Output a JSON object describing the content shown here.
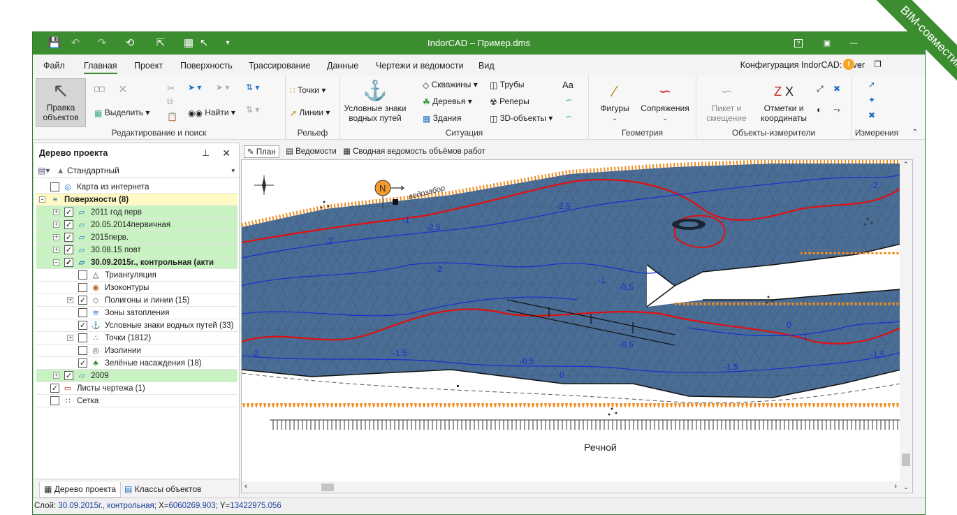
{
  "window": {
    "title": "IndorCAD – Пример.dms"
  },
  "menu": {
    "items": [
      "Файл",
      "Главная",
      "Проект",
      "Поверхность",
      "Трассирование",
      "Данные",
      "Чертежи и ведомости",
      "Вид"
    ],
    "config_label": "Конфигурация IndorCAD: River"
  },
  "ribbon": {
    "edit_objects": "Правка объектов",
    "select": "Выделить",
    "find": "Найти",
    "group_edit": "Редактирование и поиск",
    "points": "Точки",
    "lines": "Линии",
    "group_relief": "Рельеф",
    "water_signs": "Условные знаки водных путей",
    "wells": "Скважины",
    "trees": "Деревья",
    "buildings": "Здания",
    "pipes": "Трубы",
    "benchmarks": "Реперы",
    "objects3d": "3D-объекты",
    "text_glyph": "Aa",
    "group_situation": "Ситуация",
    "figures": "Фигуры",
    "joins": "Сопряжения",
    "group_geometry": "Геометрия",
    "picket": "Пикет и смещение",
    "marks": "Отметки и координаты",
    "group_measure_objects": "Объекты-измерители",
    "group_measure": "Измерения"
  },
  "left_panel": {
    "title": "Дерево проекта",
    "style": "Стандартный",
    "tree": [
      {
        "label": "Карта из интернета",
        "level": 0,
        "checked": false,
        "expand": "",
        "bg": "",
        "bold": false,
        "icon": "globe-icon"
      },
      {
        "label": "Поверхности (8)",
        "level": 0,
        "checked": null,
        "expand": "-",
        "bg": "yellow",
        "bold": true,
        "icon": "surfaces-icon"
      },
      {
        "label": "2011 год перв",
        "level": 1,
        "checked": true,
        "expand": "+",
        "bg": "green",
        "bold": false,
        "icon": "surface-icon"
      },
      {
        "label": "20.05.2014первичная",
        "level": 1,
        "checked": true,
        "expand": "+",
        "bg": "green",
        "bold": false,
        "icon": "surface-icon"
      },
      {
        "label": "2015перв.",
        "level": 1,
        "checked": true,
        "expand": "+",
        "bg": "green",
        "bold": false,
        "icon": "surface-icon"
      },
      {
        "label": "30.08.15 повт",
        "level": 1,
        "checked": true,
        "expand": "+",
        "bg": "green",
        "bold": false,
        "icon": "surface-icon"
      },
      {
        "label": "30.09.2015г., контрольная (акти",
        "level": 1,
        "checked": true,
        "expand": "-",
        "bg": "green",
        "bold": true,
        "icon": "surface-icon"
      },
      {
        "label": "Триангуляция",
        "level": 2,
        "checked": false,
        "expand": "",
        "bg": "",
        "bold": false,
        "icon": "triangle-icon"
      },
      {
        "label": "Изоконтуры",
        "level": 2,
        "checked": false,
        "expand": "",
        "bg": "",
        "bold": false,
        "icon": "isocontour-icon"
      },
      {
        "label": "Полигоны и линии (15)",
        "level": 2,
        "checked": true,
        "expand": "+",
        "bg": "",
        "bold": false,
        "icon": "polygon-icon"
      },
      {
        "label": "Зоны затопления",
        "level": 2,
        "checked": false,
        "expand": "",
        "bg": "",
        "bold": false,
        "icon": "flood-icon"
      },
      {
        "label": "Условные знаки водных путей (33)",
        "level": 2,
        "checked": true,
        "expand": "",
        "bg": "",
        "bold": false,
        "icon": "anchor-icon"
      },
      {
        "label": "Точки (1812)",
        "level": 2,
        "checked": false,
        "expand": "+",
        "bg": "",
        "bold": false,
        "icon": "points-icon"
      },
      {
        "label": "Изолинии",
        "level": 2,
        "checked": false,
        "expand": "",
        "bg": "",
        "bold": false,
        "icon": "isoline-icon"
      },
      {
        "label": "Зелёные насаждения (18)",
        "level": 2,
        "checked": true,
        "expand": "",
        "bg": "",
        "bold": false,
        "icon": "tree-icon"
      },
      {
        "label": "2009",
        "level": 1,
        "checked": true,
        "expand": "+",
        "bg": "green",
        "bold": false,
        "icon": "surface-icon"
      },
      {
        "label": "Листы чертежа (1)",
        "level": 0,
        "checked": true,
        "expand": "",
        "bg": "",
        "bold": false,
        "icon": "sheet-icon"
      },
      {
        "label": "Сетка",
        "level": 0,
        "checked": false,
        "expand": "",
        "bg": "",
        "bold": false,
        "icon": "grid-icon"
      }
    ],
    "tabs": [
      "Дерево проекта",
      "Классы объектов"
    ]
  },
  "doc_tabs": [
    "План",
    "Ведомости",
    "Сводная ведомость объёмов работ"
  ],
  "map": {
    "labels": {
      "intake": "водозабор",
      "river": "Речной",
      "north": "N"
    },
    "depths": [
      "-2.5",
      "-2",
      "-2",
      "-1",
      "-0.5",
      "-1.5",
      "-0.5",
      "0",
      "-2",
      "-1",
      "-1.5",
      "-2.5",
      "-1.5",
      "0",
      "-0.5",
      "-1",
      "-2"
    ],
    "colors": {
      "water": "#4a6d95",
      "deep_line": "#1530d0",
      "edge_line": "#e01010",
      "shore": "#f28c1e"
    }
  },
  "status": {
    "layer_label": "Слой:",
    "layer_value": "30.09.2015г., контрольная",
    "x_label": "X=",
    "x_value": "6060269.903",
    "y_label": "Y=",
    "y_value": "13422975.056"
  },
  "badge": {
    "text": "BIM-совместимо"
  }
}
